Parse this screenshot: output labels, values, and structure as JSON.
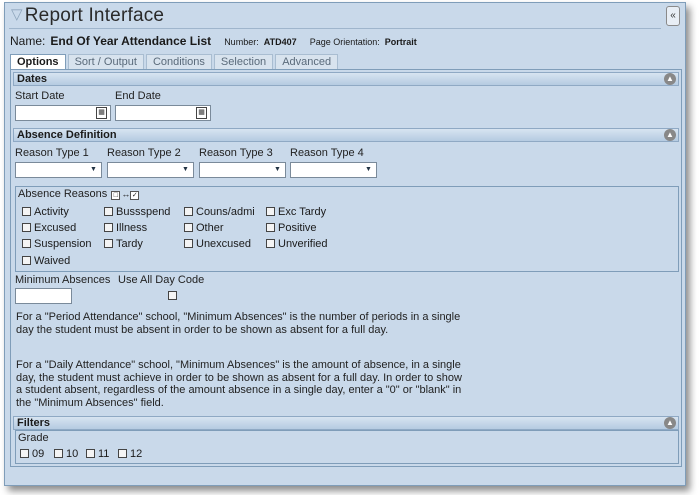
{
  "window": {
    "title": "Report Interface",
    "collapse_label": "«"
  },
  "report": {
    "name_label": "Name:",
    "name_value": "End Of Year Attendance List",
    "number_label": "Number:",
    "number_value": "ATD407",
    "orientation_label": "Page Orientation:",
    "orientation_value": "Portrait"
  },
  "tabs": [
    {
      "label": "Options",
      "active": true
    },
    {
      "label": "Sort / Output",
      "active": false
    },
    {
      "label": "Conditions",
      "active": false
    },
    {
      "label": "Selection",
      "active": false
    },
    {
      "label": "Advanced",
      "active": false
    }
  ],
  "dates": {
    "header": "Dates",
    "start_label": "Start Date",
    "start_value": "",
    "end_label": "End Date",
    "end_value": ""
  },
  "absence": {
    "header": "Absence Definition",
    "reason_types": [
      {
        "label": "Reason Type 1",
        "value": ""
      },
      {
        "label": "Reason Type 2",
        "value": ""
      },
      {
        "label": "Reason Type 3",
        "value": ""
      },
      {
        "label": "Reason Type 4",
        "value": ""
      }
    ],
    "reasons_label": "Absence Reasons",
    "reasons": [
      [
        "Activity",
        "Bussspend",
        "Couns/admi",
        "Exc Tardy"
      ],
      [
        "Excused",
        "Illness",
        "Other",
        "Positive"
      ],
      [
        "Suspension",
        "Tardy",
        "Unexcused",
        "Unverified"
      ],
      [
        "Waived"
      ]
    ],
    "min_label": "Minimum Absences",
    "min_value": "",
    "allday_label": "Use All Day Code",
    "note_period": "For a \"Period Attendance\" school, \"Minimum Absences\" is the number of periods in a single day the student must be absent in order to be shown as absent for a full day.",
    "note_daily": "For a \"Daily Attendance\" school, \"Minimum Absences\" is the amount of absence, in a single day, the student must achieve in order to be shown as absent for a full day. In order to show a student absent, regardless of the amount absence in a single day, enter a \"0\" or \"blank\" in the \"Minimum Absences\" field."
  },
  "filters": {
    "header": "Filters",
    "grade_label": "Grade",
    "grades": [
      "09",
      "10",
      "11",
      "12"
    ]
  },
  "icons": {
    "title": "funnel-icon",
    "calendar": "calendar-icon",
    "dropdown": "chevron-down-icon",
    "section_toggle": "collapse-circle-icon"
  }
}
